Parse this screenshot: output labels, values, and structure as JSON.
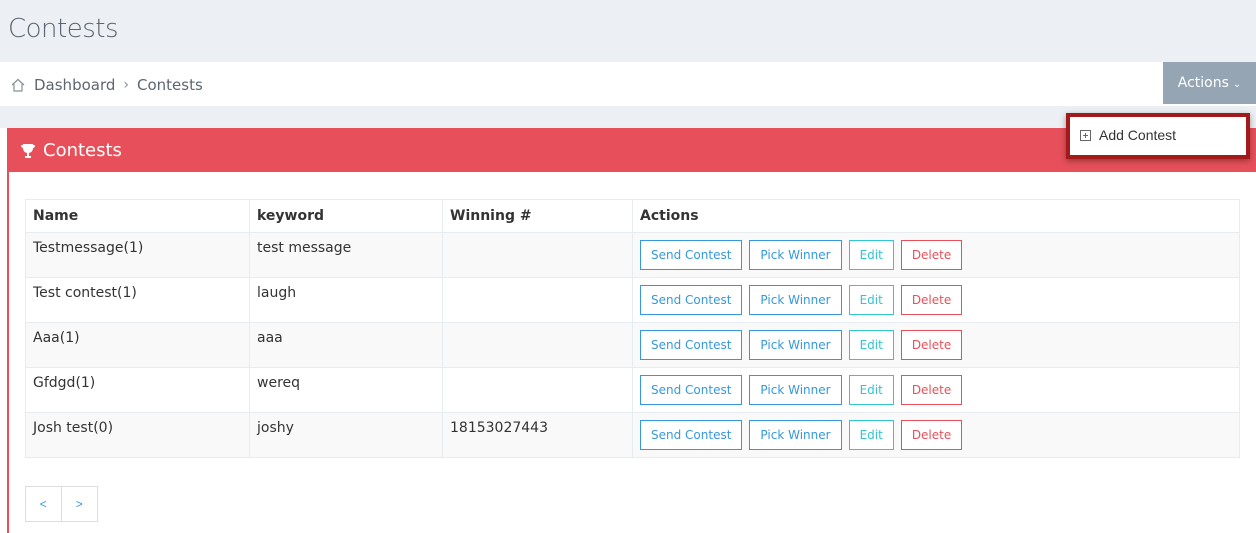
{
  "page": {
    "title": "Contests"
  },
  "breadcrumb": {
    "items": [
      "Dashboard",
      "Contests"
    ],
    "separator": "›"
  },
  "header_actions": {
    "label": "Actions",
    "chevron": "⌄"
  },
  "dropdown": {
    "items": [
      {
        "label": "Add Contest",
        "icon": "plus-square-icon"
      }
    ]
  },
  "portlet": {
    "title": "Contests",
    "icon": "trophy-icon",
    "color": "#e7505a"
  },
  "table": {
    "columns": [
      "Name",
      "keyword",
      "Winning #",
      "Actions"
    ],
    "rows": [
      {
        "name": "Testmessage(1)",
        "keyword": "test message",
        "winning": ""
      },
      {
        "name": "Test contest(1)",
        "keyword": "laugh",
        "winning": ""
      },
      {
        "name": "Aaa(1)",
        "keyword": "aaa",
        "winning": ""
      },
      {
        "name": "Gfdgd(1)",
        "keyword": "wereq",
        "winning": ""
      },
      {
        "name": "Josh test(0)",
        "keyword": "joshy",
        "winning": "18153027443"
      }
    ],
    "row_actions": {
      "send": "Send Contest",
      "pick": "Pick Winner",
      "edit": "Edit",
      "delete": "Delete"
    }
  },
  "pagination": {
    "prev": "<",
    "next": ">"
  },
  "colors": {
    "accent_red": "#e7505a",
    "blue": "#3598dc",
    "cyan": "#32c5d2",
    "actions_button": "#95a5b3",
    "highlight_border": "#a31a1a"
  }
}
